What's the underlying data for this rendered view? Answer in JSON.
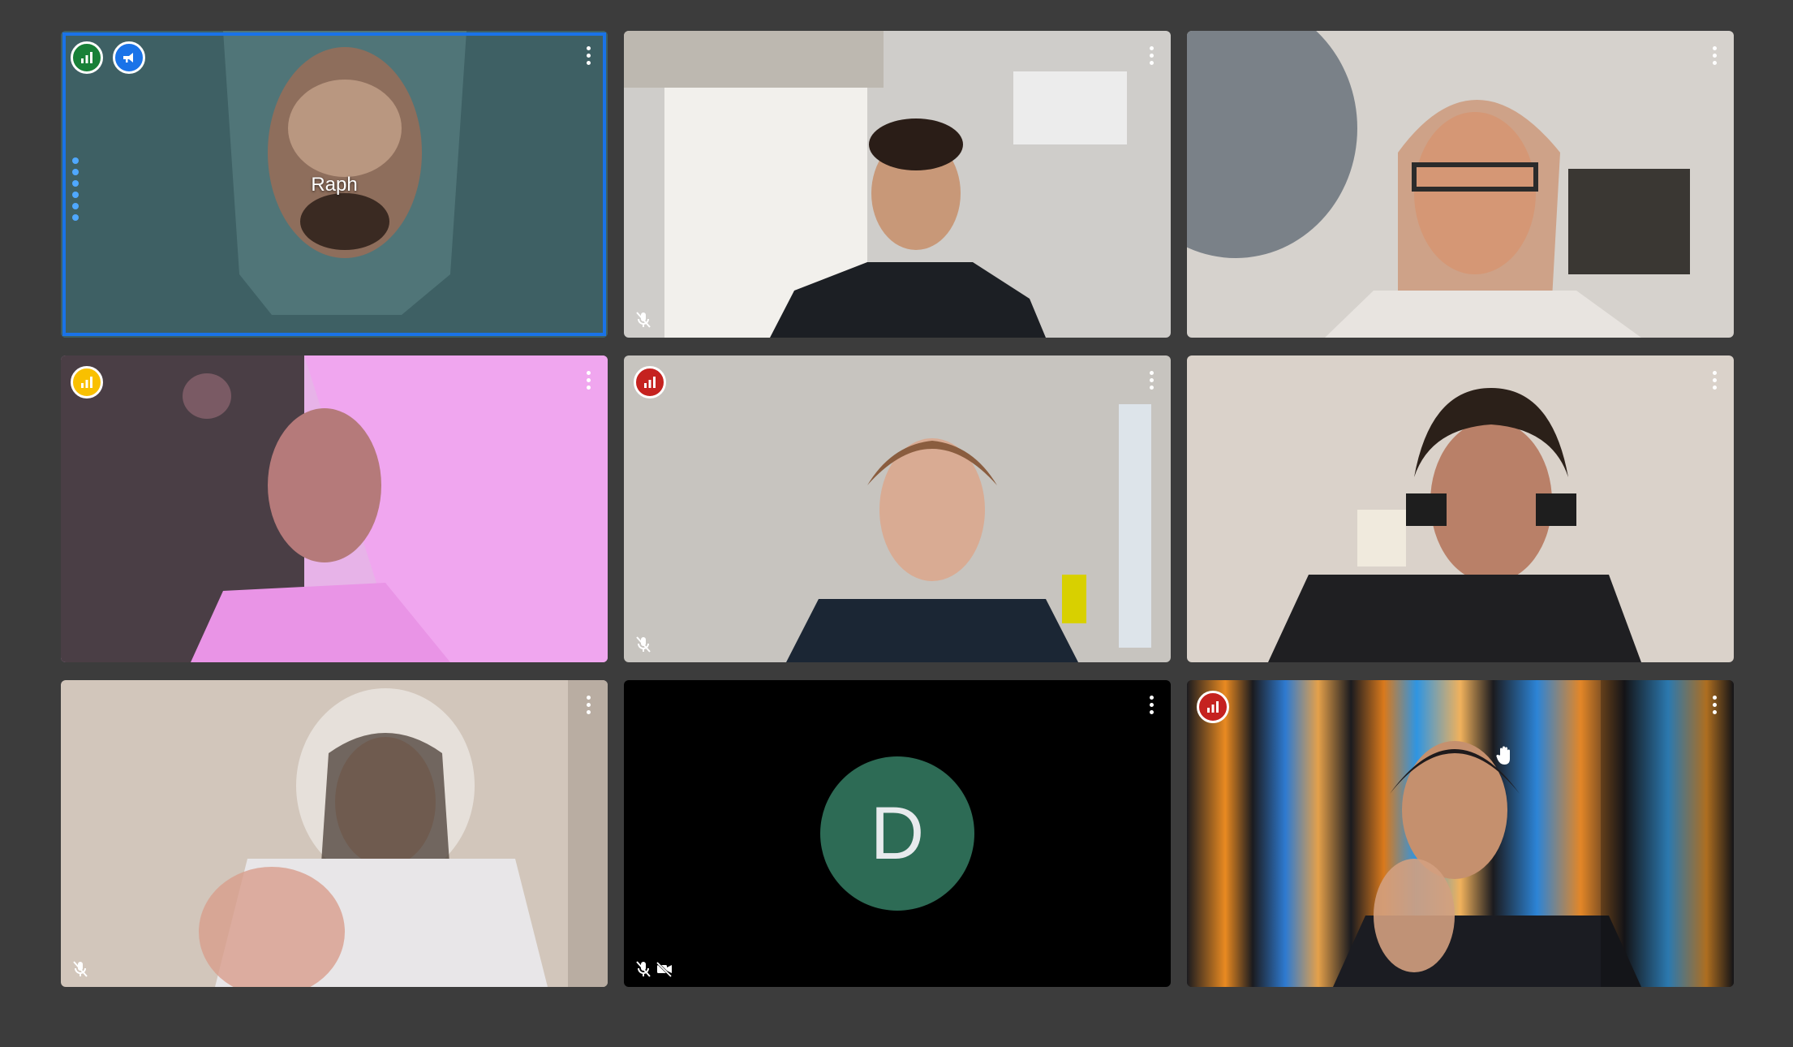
{
  "meeting": {
    "tiles": [
      {
        "name": "Raph",
        "show_name": true,
        "active_speaker": true,
        "badges": [
          {
            "icon": "signal-bars-icon",
            "color": "#188038"
          },
          {
            "icon": "megaphone-icon",
            "color": "#1a73e8"
          }
        ],
        "muted": false,
        "camera_off": false,
        "background": "#3e6064"
      },
      {
        "name": "",
        "muted": true,
        "camera_off": false,
        "background": "#c9c7c3"
      },
      {
        "name": "",
        "muted": false,
        "camera_off": false,
        "background": "#d4d0cc"
      },
      {
        "name": "",
        "muted": false,
        "camera_off": false,
        "badges": [
          {
            "icon": "signal-bars-icon",
            "color": "#f9c000"
          }
        ],
        "background": "#d77ad7"
      },
      {
        "name": "",
        "muted": true,
        "camera_off": false,
        "badges": [
          {
            "icon": "signal-bars-icon",
            "color": "#c5221f"
          }
        ],
        "background": "#c0bdb8"
      },
      {
        "name": "",
        "muted": false,
        "camera_off": false,
        "background": "#d8cfc6"
      },
      {
        "name": "",
        "muted": true,
        "camera_off": false,
        "background": "#cfc7bf"
      },
      {
        "name": "",
        "muted": true,
        "camera_off": true,
        "avatar_letter": "D",
        "avatar_color": "#2d6b55",
        "background": "#000000"
      },
      {
        "name": "",
        "muted": false,
        "camera_off": false,
        "hand_raised": true,
        "badges": [
          {
            "icon": "signal-bars-icon",
            "color": "#c5221f"
          }
        ],
        "background": "#1c2b45"
      }
    ]
  }
}
